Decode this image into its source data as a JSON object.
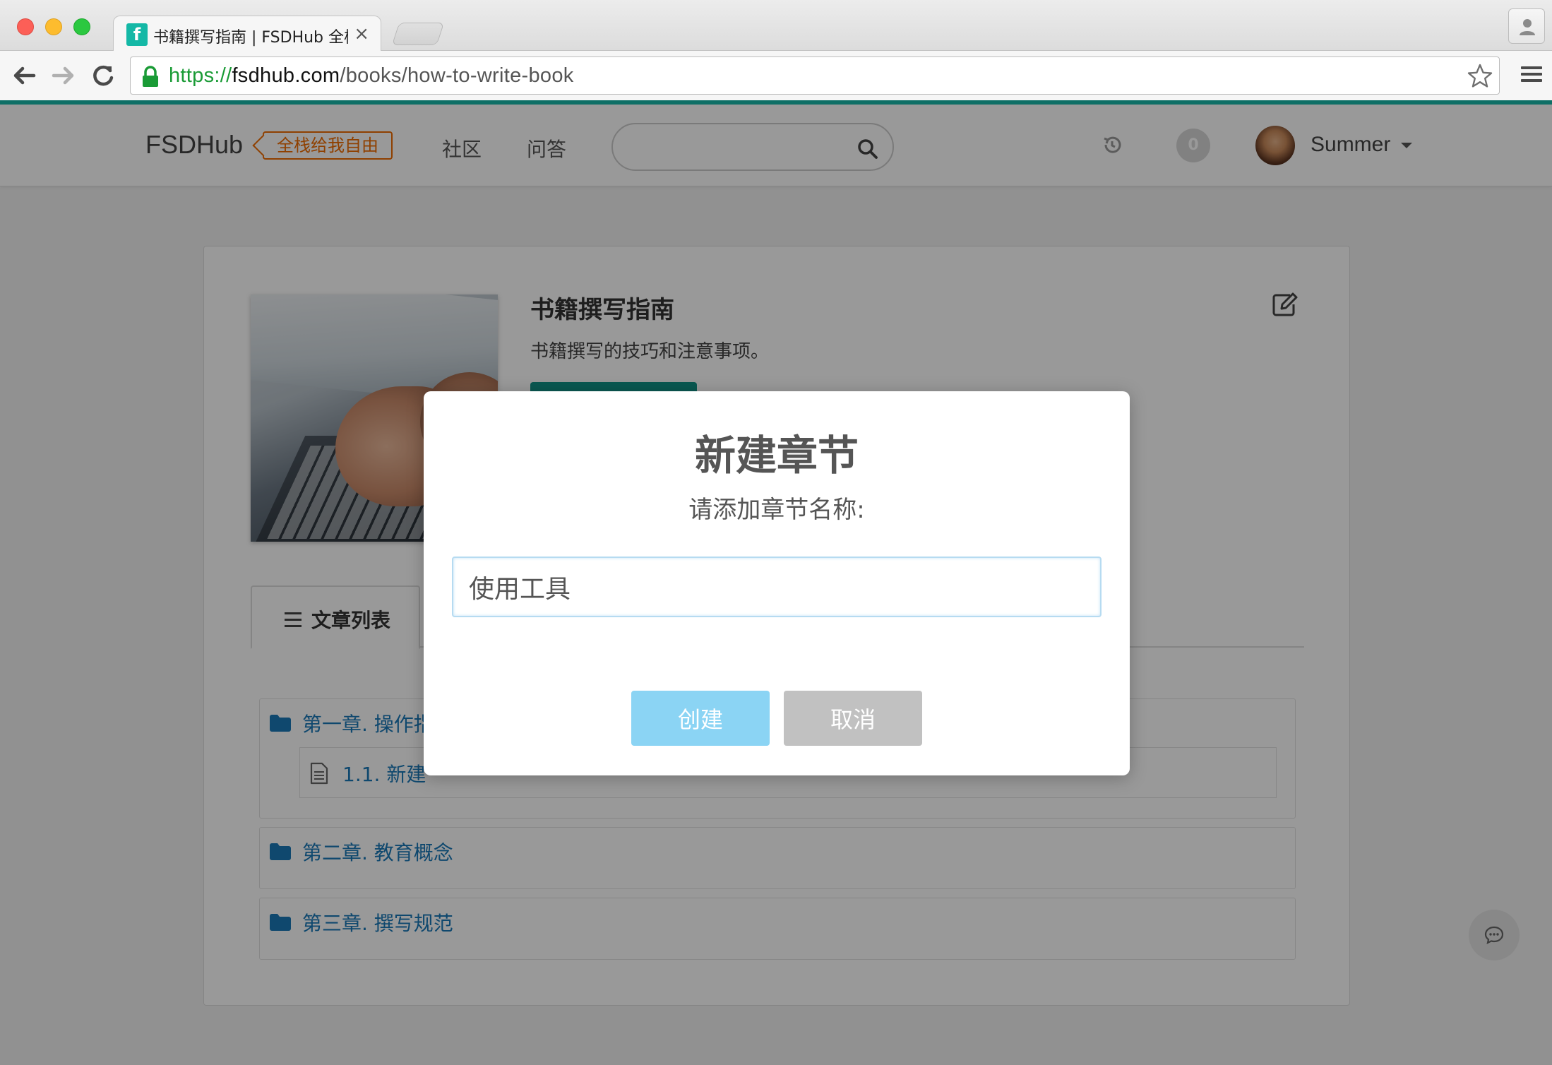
{
  "browser": {
    "tab_title": "书籍撰写指南 | FSDHub 全栈",
    "tab_favicon": "f",
    "tab_close": "×",
    "url_scheme": "https://",
    "url_host": "fsdhub.com",
    "url_path": "/books/how-to-write-book"
  },
  "header": {
    "logo": "FSDHub",
    "slogan": "全栈给我自由",
    "nav": [
      "社区",
      "问答"
    ],
    "notification_count": "0",
    "username": "Summer"
  },
  "book": {
    "title": "书籍撰写指南",
    "description": "书籍撰写的技巧和注意事项。",
    "tab_label": "文章列表",
    "chapters": [
      {
        "label": "第一章. 操作指",
        "items": [
          {
            "label": "1.1. 新建"
          }
        ]
      },
      {
        "label": "第二章. 教育概念"
      },
      {
        "label": "第三章. 撰写规范"
      }
    ]
  },
  "modal": {
    "title": "新建章节",
    "subtitle": "请添加章节名称:",
    "input_value": "使用工具",
    "create_label": "创建",
    "cancel_label": "取消"
  },
  "colors": {
    "accent": "#119387",
    "link": "#1978b8",
    "slogan": "#ef6c00",
    "create_button": "#8bd4f4",
    "cancel_button": "#c1c1c1"
  }
}
